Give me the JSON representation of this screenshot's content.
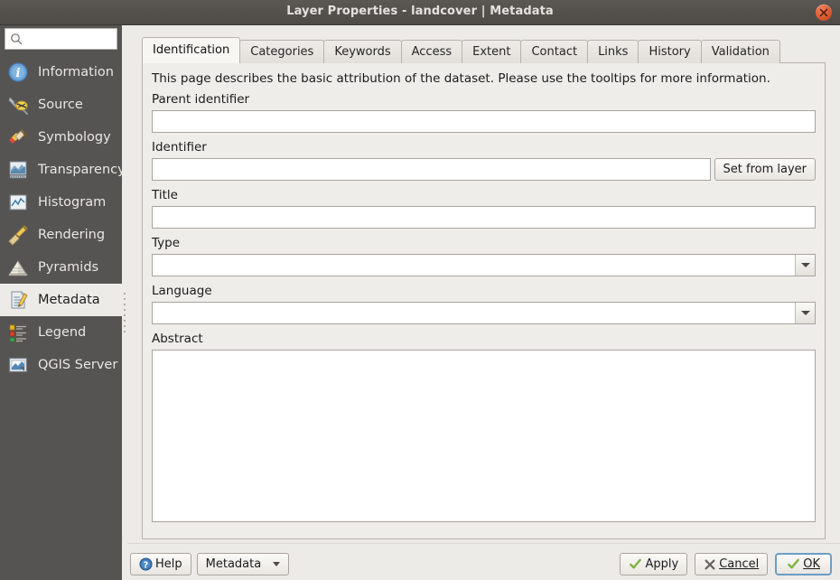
{
  "window": {
    "title": "Layer Properties - landcover | Metadata",
    "close_icon": "close-icon"
  },
  "sidebar": {
    "search": {
      "placeholder": "",
      "value": "",
      "icon": "search-icon"
    },
    "items": [
      {
        "label": "Information",
        "icon": "information-icon",
        "selected": false
      },
      {
        "label": "Source",
        "icon": "source-wrench-icon",
        "selected": false
      },
      {
        "label": "Symbology",
        "icon": "symbology-brush-icon",
        "selected": false
      },
      {
        "label": "Transparency",
        "icon": "transparency-icon",
        "selected": false
      },
      {
        "label": "Histogram",
        "icon": "histogram-icon",
        "selected": false
      },
      {
        "label": "Rendering",
        "icon": "rendering-broom-icon",
        "selected": false
      },
      {
        "label": "Pyramids",
        "icon": "pyramids-icon",
        "selected": false
      },
      {
        "label": "Metadata",
        "icon": "metadata-icon",
        "selected": true
      },
      {
        "label": "Legend",
        "icon": "legend-icon",
        "selected": false
      },
      {
        "label": "QGIS Server",
        "icon": "qgis-server-icon",
        "selected": false
      }
    ]
  },
  "tabs": [
    {
      "label": "Identification",
      "active": true
    },
    {
      "label": "Categories",
      "active": false
    },
    {
      "label": "Keywords",
      "active": false
    },
    {
      "label": "Access",
      "active": false
    },
    {
      "label": "Extent",
      "active": false
    },
    {
      "label": "Contact",
      "active": false
    },
    {
      "label": "Links",
      "active": false
    },
    {
      "label": "History",
      "active": false
    },
    {
      "label": "Validation",
      "active": false
    }
  ],
  "form": {
    "help_text": "This page describes the basic attribution of the dataset. Please use the tooltips for more information.",
    "parent_identifier": {
      "label": "Parent identifier",
      "value": "",
      "placeholder": ""
    },
    "identifier": {
      "label": "Identifier",
      "value": "",
      "placeholder": "",
      "button_label": "Set from layer"
    },
    "title": {
      "label": "Title",
      "value": "",
      "placeholder": ""
    },
    "type": {
      "label": "Type",
      "value": "",
      "options": []
    },
    "language": {
      "label": "Language",
      "value": "",
      "options": []
    },
    "abstract": {
      "label": "Abstract",
      "value": "",
      "placeholder": ""
    }
  },
  "footer": {
    "help_label": "Help",
    "metadata_label": "Metadata",
    "apply_label": "Apply",
    "cancel_label": "Cancel",
    "ok_label": "OK"
  },
  "colors": {
    "titlebar": "#54514d",
    "sidebar": "#565452",
    "panel": "#edebe7",
    "accent_focus": "#6d9dc5",
    "close_button": "#db5a30",
    "check_green": "#7fb441"
  }
}
